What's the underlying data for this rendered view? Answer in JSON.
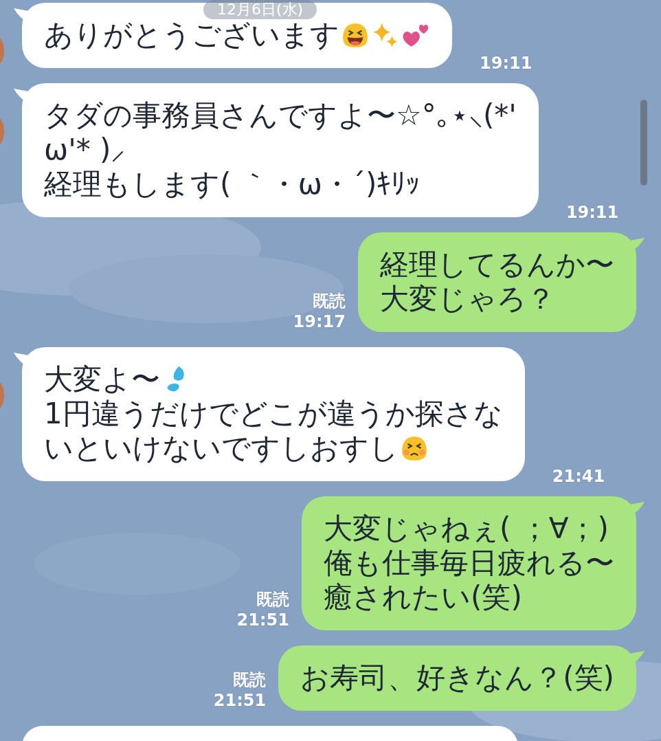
{
  "date_label": "12月6日(水)",
  "messages": [
    {
      "kind": "incoming",
      "lines": [
        {
          "text": "ありがとうございます",
          "icons": [
            {
              "kind": "laughing-face"
            },
            {
              "kind": "sparkles"
            },
            {
              "kind": "hearts"
            }
          ]
        }
      ],
      "time": "19:11"
    },
    {
      "kind": "incoming",
      "lines": [
        {
          "text": "タダの事務員さんですよ〜☆°｡⋆⸜(*'"
        },
        {
          "text": "ω'* )⸝"
        },
        {
          "text": "経理もします( ｀・ω・´)ｷﾘｯ"
        }
      ],
      "time": "19:11"
    },
    {
      "kind": "outgoing",
      "lines": [
        {
          "text": "経理してるんか〜"
        },
        {
          "text": "大変じゃろ？"
        }
      ],
      "read": "既読",
      "time": "19:17"
    },
    {
      "kind": "incoming",
      "lines": [
        {
          "text": "大変よ〜",
          "icons": [
            {
              "kind": "sweat-drops"
            }
          ]
        },
        {
          "text": "1円違うだけでどこが違うか探さな"
        },
        {
          "text": "いといけないですしおすし",
          "icons": [
            {
              "kind": "grimacing-face"
            }
          ]
        }
      ],
      "time": "21:41"
    },
    {
      "kind": "outgoing",
      "lines": [
        {
          "text": "大変じゃねぇ( ；∀；)"
        },
        {
          "text": "俺も仕事毎日疲れる〜"
        },
        {
          "text": "癒されたい(笑)"
        }
      ],
      "read": "既読",
      "time": "21:51"
    },
    {
      "kind": "outgoing",
      "lines": [
        {
          "text": "お寿司、好きなん？(笑)"
        }
      ],
      "read": "既読",
      "time": "21:51"
    }
  ]
}
